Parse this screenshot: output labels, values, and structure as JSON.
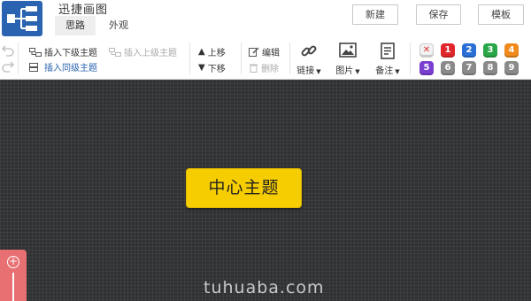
{
  "app": {
    "title": "迅捷画图"
  },
  "tabs": [
    {
      "label": "思路",
      "active": true
    },
    {
      "label": "外观",
      "active": false
    }
  ],
  "header_buttons": {
    "new": "新建",
    "save": "保存",
    "template": "模板"
  },
  "toolbar": {
    "insert_child": "插入下级主题",
    "insert_parent": "插入上级主题",
    "insert_sibling": "插入同级主题",
    "move_up": "上移",
    "move_down": "下移",
    "edit": "编辑",
    "delete": "删除",
    "link": "链接",
    "image": "图片",
    "note": "备注"
  },
  "priority_badges": [
    {
      "label": "✕",
      "color": "#f2f2f2",
      "text_color": "#d33"
    },
    {
      "label": "1",
      "color": "#e0262a"
    },
    {
      "label": "2",
      "color": "#2a6fd6"
    },
    {
      "label": "3",
      "color": "#2aa748"
    },
    {
      "label": "4",
      "color": "#f08a1c"
    },
    {
      "label": "5",
      "color": "#7a3fd0"
    },
    {
      "label": "6",
      "color": "#8a8a8a"
    },
    {
      "label": "7",
      "color": "#8a8a8a"
    },
    {
      "label": "8",
      "color": "#8a8a8a"
    },
    {
      "label": "9",
      "color": "#8a8a8a"
    }
  ],
  "canvas": {
    "central_topic": "中心主题",
    "background": "#2f3133",
    "topic_color": "#f6cd00"
  },
  "watermark": "tuhuaba.com",
  "colors": {
    "brand": "#2a64b0",
    "zoom_panel": "#e86f72"
  }
}
